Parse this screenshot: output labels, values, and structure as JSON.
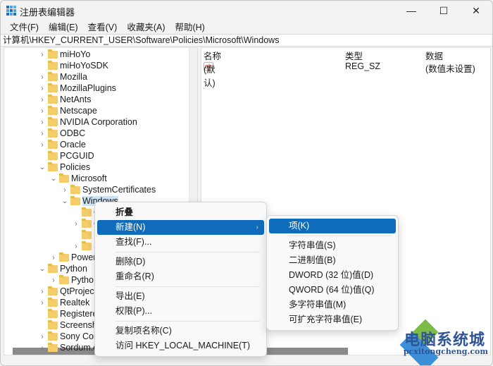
{
  "window": {
    "title": "注册表编辑器",
    "controls": {
      "minimize": "—",
      "maximize": "☐",
      "close": "✕"
    }
  },
  "menubar": [
    {
      "label": "文件(F)"
    },
    {
      "label": "编辑(E)"
    },
    {
      "label": "查看(V)"
    },
    {
      "label": "收藏夹(A)"
    },
    {
      "label": "帮助(H)"
    }
  ],
  "address": "计算机\\HKEY_CURRENT_USER\\Software\\Policies\\Microsoft\\Windows",
  "tree": [
    {
      "label": "miHoYo",
      "expander": "›"
    },
    {
      "label": "miHoYoSDK",
      "expander": ""
    },
    {
      "label": "Mozilla",
      "expander": "›"
    },
    {
      "label": "MozillaPlugins",
      "expander": "›"
    },
    {
      "label": "NetAnts",
      "expander": "›"
    },
    {
      "label": "Netscape",
      "expander": "›"
    },
    {
      "label": "NVIDIA Corporation",
      "expander": "›"
    },
    {
      "label": "ODBC",
      "expander": "›"
    },
    {
      "label": "Oracle",
      "expander": "›"
    },
    {
      "label": "PCGUID",
      "expander": ""
    },
    {
      "label": "Policies",
      "expander": "⌄"
    },
    {
      "label": "Microsoft",
      "expander": "⌄"
    },
    {
      "label": "SystemCertificates",
      "expander": "›"
    },
    {
      "label": "Windows",
      "expander": "⌄",
      "selected": true
    },
    {
      "label": "C",
      "expander": ""
    },
    {
      "label": "C",
      "expander": "›"
    },
    {
      "label": "I",
      "expander": ""
    },
    {
      "label": "S",
      "expander": "›"
    },
    {
      "label": "Power",
      "expander": "›"
    },
    {
      "label": "Python",
      "expander": "⌄"
    },
    {
      "label": "Pytho",
      "expander": "›"
    },
    {
      "label": "QtProjec",
      "expander": "›"
    },
    {
      "label": "Realtek",
      "expander": "›"
    },
    {
      "label": "Registere",
      "expander": ""
    },
    {
      "label": "Screensh",
      "expander": ""
    },
    {
      "label": "Sony Cor",
      "expander": "›"
    },
    {
      "label": "Sordum.org",
      "expander": "›"
    }
  ],
  "list": {
    "columns": {
      "name": "名称",
      "type": "类型",
      "data": "数据"
    },
    "rows": [
      {
        "icon": "ab",
        "name": "(默认)",
        "type": "REG_SZ",
        "data": "(数值未设置)"
      }
    ]
  },
  "context_menu": {
    "items": [
      {
        "label": "折叠",
        "bold": true
      },
      {
        "label": "新建(N)",
        "highlight": true,
        "submenu": true
      },
      {
        "label": "查找(F)..."
      },
      {
        "sep": true
      },
      {
        "label": "删除(D)"
      },
      {
        "label": "重命名(R)"
      },
      {
        "sep": true
      },
      {
        "label": "导出(E)"
      },
      {
        "label": "权限(P)..."
      },
      {
        "sep": true
      },
      {
        "label": "复制项名称(C)"
      },
      {
        "label": "访问 HKEY_LOCAL_MACHINE(T)"
      }
    ],
    "arrow": "›"
  },
  "submenu": {
    "items": [
      {
        "label": "项(K)",
        "highlight": true
      },
      {
        "sep": true
      },
      {
        "label": "字符串值(S)"
      },
      {
        "label": "二进制值(B)"
      },
      {
        "label": "DWORD (32 位)值(D)"
      },
      {
        "label": "QWORD (64 位)值(Q)"
      },
      {
        "label": "多字符串值(M)"
      },
      {
        "label": "可扩充字符串值(E)"
      }
    ]
  },
  "watermark": {
    "title": "电脑系统城",
    "url": "pcxitongcheng.com"
  }
}
